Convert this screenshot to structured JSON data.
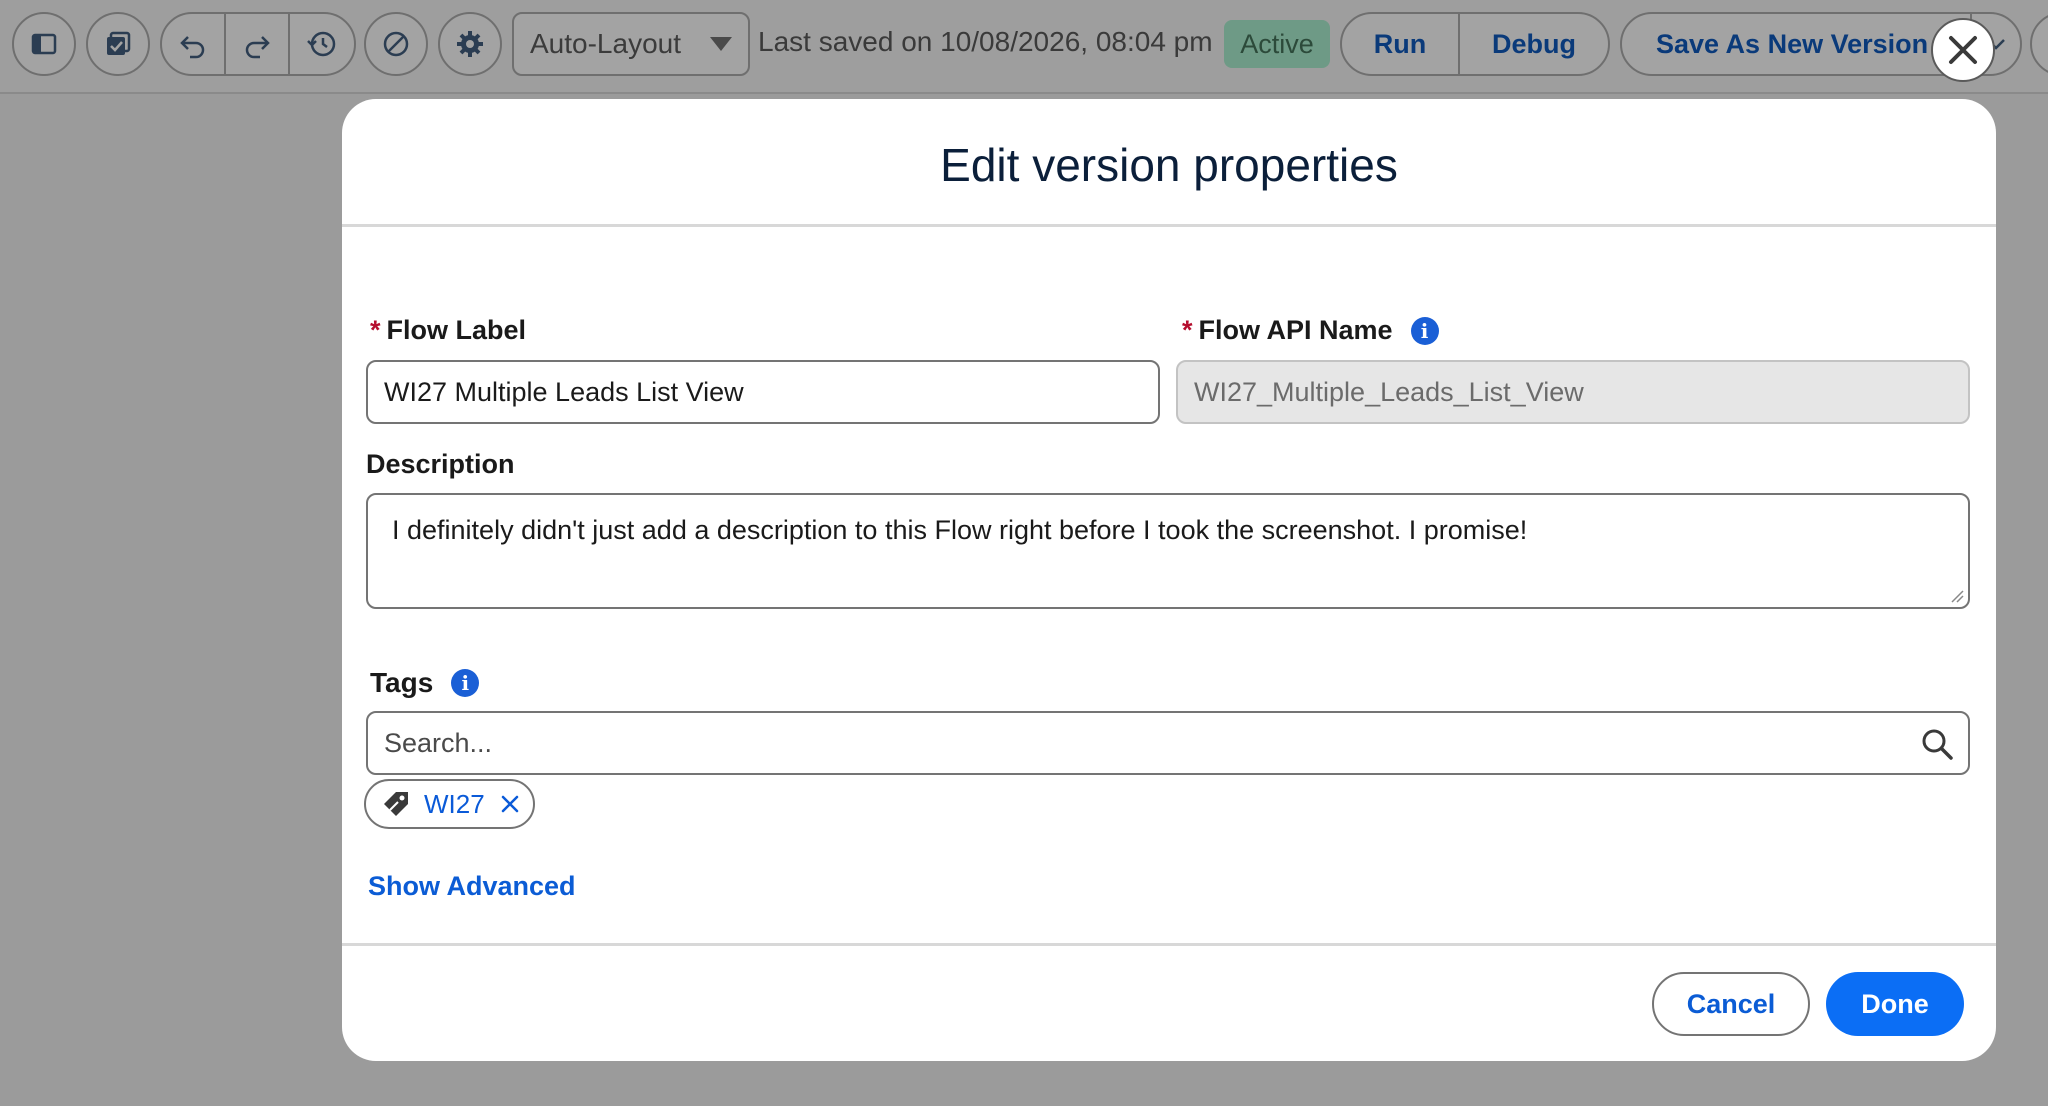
{
  "toolbar": {
    "layout_dropdown": "Auto-Layout",
    "last_saved": "Last saved on 10/08/2026, 08:04 pm",
    "status_badge": "Active",
    "run_label": "Run",
    "debug_label": "Debug",
    "save_as_new_version_label": "Save As New Version",
    "icons": [
      "panel-toggle-icon",
      "check-square-icon",
      "undo-icon",
      "redo-icon",
      "history-icon",
      "deactivate-icon",
      "gear-icon",
      "chevron-down-icon"
    ]
  },
  "modal": {
    "title": "Edit version properties",
    "flow_label": {
      "label": "Flow Label",
      "required_marker": "*",
      "value": "WI27 Multiple Leads List View"
    },
    "flow_api_name": {
      "label": "Flow API Name",
      "required_marker": "*",
      "value": "WI27_Multiple_Leads_List_View"
    },
    "description": {
      "label": "Description",
      "value": "I definitely didn't just add a description to this Flow right before I took the screenshot. I promise!"
    },
    "tags": {
      "label": "Tags",
      "search_placeholder": "Search...",
      "pills": [
        "WI27"
      ]
    },
    "show_advanced_label": "Show Advanced",
    "cancel_label": "Cancel",
    "done_label": "Done"
  },
  "colors": {
    "brand_blue": "#0b6ef5",
    "link_blue": "#0b5cd5",
    "required_red": "#b50e2e",
    "overlay_gray": "#9b9b9b",
    "active_badge": "#6e9a86"
  }
}
